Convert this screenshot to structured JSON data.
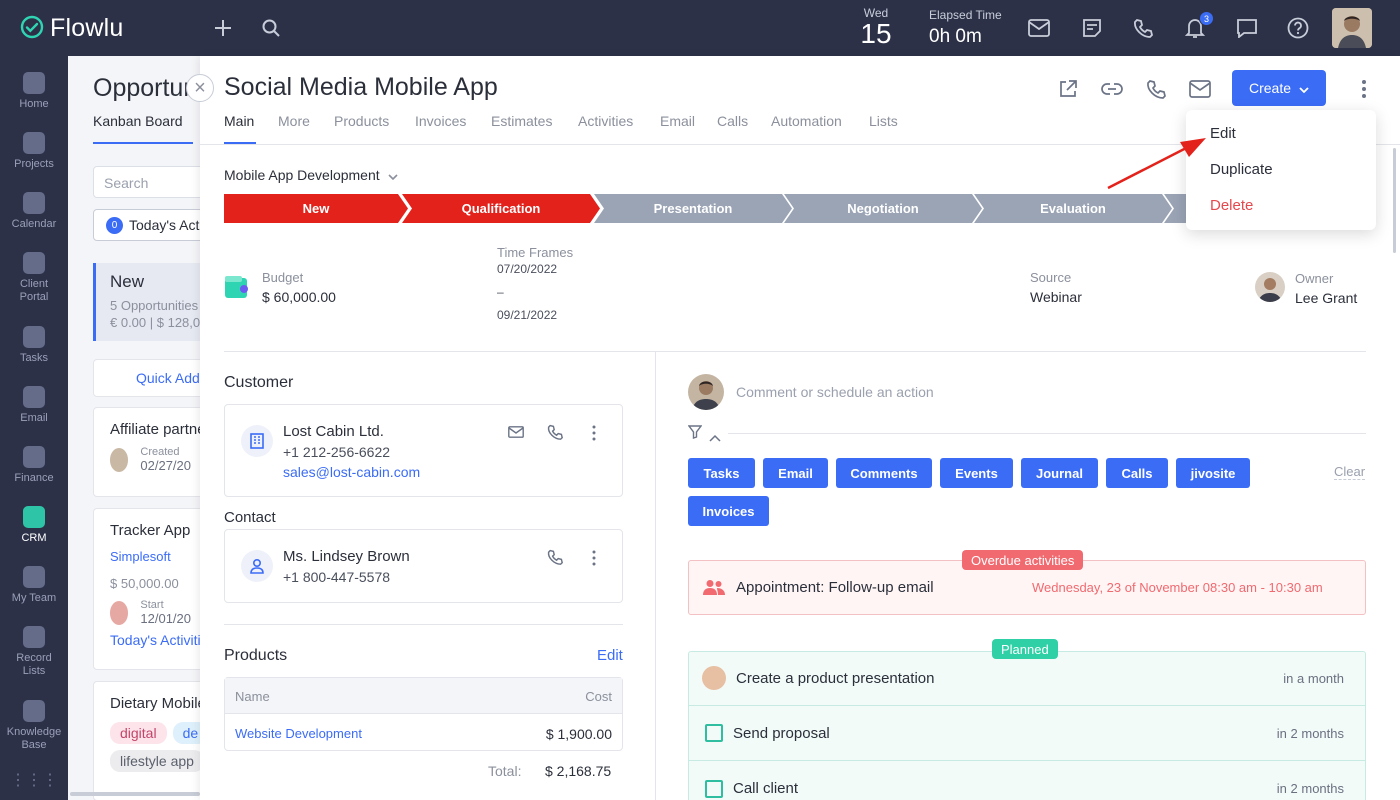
{
  "app": {
    "name": "Flowlu"
  },
  "topbar": {
    "day_name": "Wed",
    "day_number": "15",
    "elapsed_label": "Elapsed Time",
    "elapsed_value": "0h 0m",
    "notifications_count": "3"
  },
  "sidebar": {
    "items": [
      {
        "label": "Home"
      },
      {
        "label": "Projects"
      },
      {
        "label": "Calendar"
      },
      {
        "label": "Client Portal"
      },
      {
        "label": "Tasks"
      },
      {
        "label": "Email"
      },
      {
        "label": "Finance"
      },
      {
        "label": "CRM"
      },
      {
        "label": "My Team"
      },
      {
        "label": "Record Lists"
      },
      {
        "label": "Knowledge Base"
      }
    ]
  },
  "board": {
    "title": "Opportunities",
    "view_tab": "Kanban Board",
    "search_placeholder": "Search",
    "today_count": "0",
    "today_label": "Today's Activities",
    "column_title": "New",
    "column_subtitle": "5 Opportunities",
    "column_sum": "€ 0.00 | $ 128,0",
    "quick_add": "Quick Add",
    "cards": [
      {
        "title": "Affiliate partner",
        "meta_label": "Created",
        "meta_value": "02/27/20"
      },
      {
        "title": "Tracker App",
        "company": "Simplesoft",
        "amount": "$ 50,000.00",
        "meta_label": "Start",
        "meta_value": "12/01/20",
        "link": "Today's Activities"
      },
      {
        "title": "Dietary Mobile",
        "tags": [
          "digital",
          "de",
          "lifestyle app"
        ]
      }
    ]
  },
  "opportunity": {
    "title": "Social Media Mobile App",
    "tabs": [
      "Main",
      "More",
      "Products",
      "Invoices",
      "Estimates",
      "Activities",
      "Email",
      "Calls",
      "Automation",
      "Lists"
    ],
    "create_label": "Create",
    "menu": {
      "edit": "Edit",
      "duplicate": "Duplicate",
      "delete": "Delete"
    },
    "pipeline_name": "Mobile App Development",
    "stages": [
      "New",
      "Qualification",
      "Presentation",
      "Negotiation",
      "Evaluation"
    ],
    "colors": {
      "stage_done": "#e3221b",
      "stage_todo": "#9aa4b5",
      "accent": "#3b6cf6",
      "overdue": "#f06a70",
      "planned": "#2fd0a5"
    },
    "budget_label": "Budget",
    "budget_value": "$ 60,000.00",
    "timeframes_label": "Time Frames",
    "timeframe_start": "07/20/2022",
    "timeframe_sep": "–",
    "timeframe_end": "09/21/2022",
    "source_label": "Source",
    "source_value": "Webinar",
    "owner_label": "Owner",
    "owner_value": "Lee Grant",
    "customer_heading": "Customer",
    "customer": {
      "name": "Lost Cabin Ltd.",
      "phone": "+1 212-256-6622",
      "email": "sales@lost-cabin.com"
    },
    "contact_heading": "Contact",
    "contact": {
      "name": "Ms. Lindsey Brown",
      "phone": "+1 800-447-5578"
    },
    "products_heading": "Products",
    "products_edit": "Edit",
    "products_table": {
      "col_name": "Name",
      "col_cost": "Cost",
      "rows": [
        {
          "name": "Website Development",
          "cost": "$ 1,900.00"
        }
      ],
      "total_label": "Total:",
      "total_value": "$ 2,168.75"
    },
    "comment_placeholder": "Comment or schedule an action",
    "filters": [
      "Tasks",
      "Email",
      "Comments",
      "Events",
      "Journal",
      "Calls",
      "jivosite",
      "Invoices"
    ],
    "clear_label": "Clear",
    "overdue_label": "Overdue activities",
    "overdue_item": {
      "title": "Appointment: Follow-up email",
      "when": "Wednesday, 23 of November 08:30 am - 10:30 am"
    },
    "planned_label": "Planned",
    "planned_items": [
      {
        "title": "Create a product presentation",
        "when": "in a month"
      },
      {
        "title": "Send proposal",
        "when": "in 2 months"
      },
      {
        "title": "Call client",
        "when": "in 2 months"
      }
    ]
  }
}
